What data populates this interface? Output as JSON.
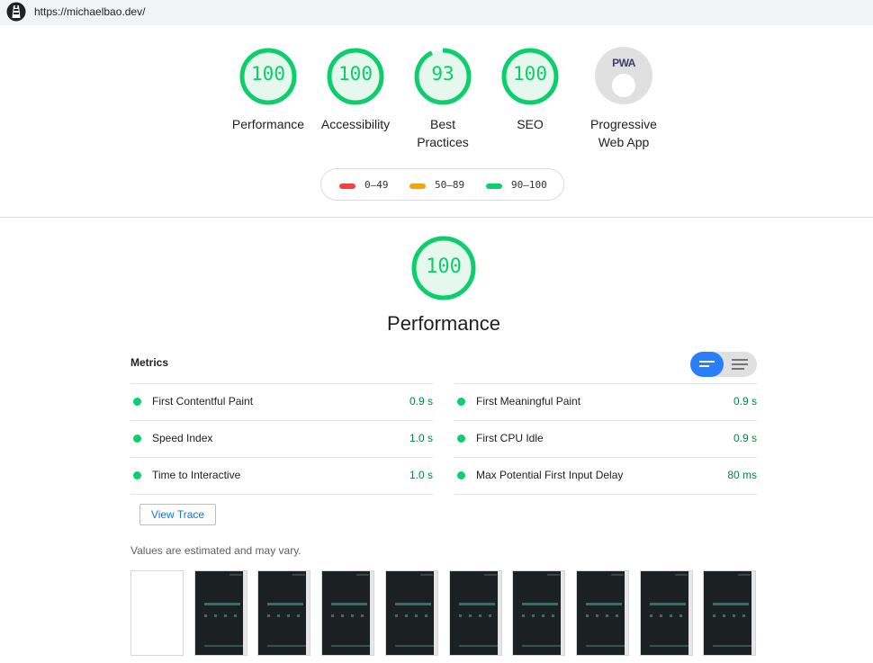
{
  "browser": {
    "url": "https://michaelbao.dev/",
    "logo_icon": "lighthouse-icon"
  },
  "summary": {
    "categories": [
      {
        "label": "Performance",
        "score": "100",
        "fraction": 1.0
      },
      {
        "label": "Accessibility",
        "score": "100",
        "fraction": 1.0
      },
      {
        "label": "Best Practices",
        "score": "93",
        "fraction": 0.93
      },
      {
        "label": "SEO",
        "score": "100",
        "fraction": 1.0
      },
      {
        "label": "Progressive Web App",
        "badge_text": "PWA"
      }
    ]
  },
  "legend": [
    {
      "range": "0–49",
      "color": "#f4433c"
    },
    {
      "range": "50–89",
      "color": "#f4a30c"
    },
    {
      "range": "90–100",
      "color": "#0cce6b"
    }
  ],
  "performance": {
    "score": "100",
    "fraction": 1.0,
    "title": "Performance",
    "metrics_header": "Metrics",
    "metrics_left": [
      {
        "name": "First Contentful Paint",
        "value": "0.9 s"
      },
      {
        "name": "Speed Index",
        "value": "1.0 s"
      },
      {
        "name": "Time to Interactive",
        "value": "1.0 s"
      }
    ],
    "metrics_right": [
      {
        "name": "First Meaningful Paint",
        "value": "0.9 s"
      },
      {
        "name": "First CPU Idle",
        "value": "0.9 s"
      },
      {
        "name": "Max Potential First Input Delay",
        "value": "80 ms"
      }
    ],
    "view_trace_label": "View Trace",
    "disclaimer": "Values are estimated and may vary.",
    "filmstrip_frames": 10
  },
  "colors": {
    "pass": "#0cce6b",
    "pass_text": "#018642",
    "accent": "#2a7efc"
  }
}
